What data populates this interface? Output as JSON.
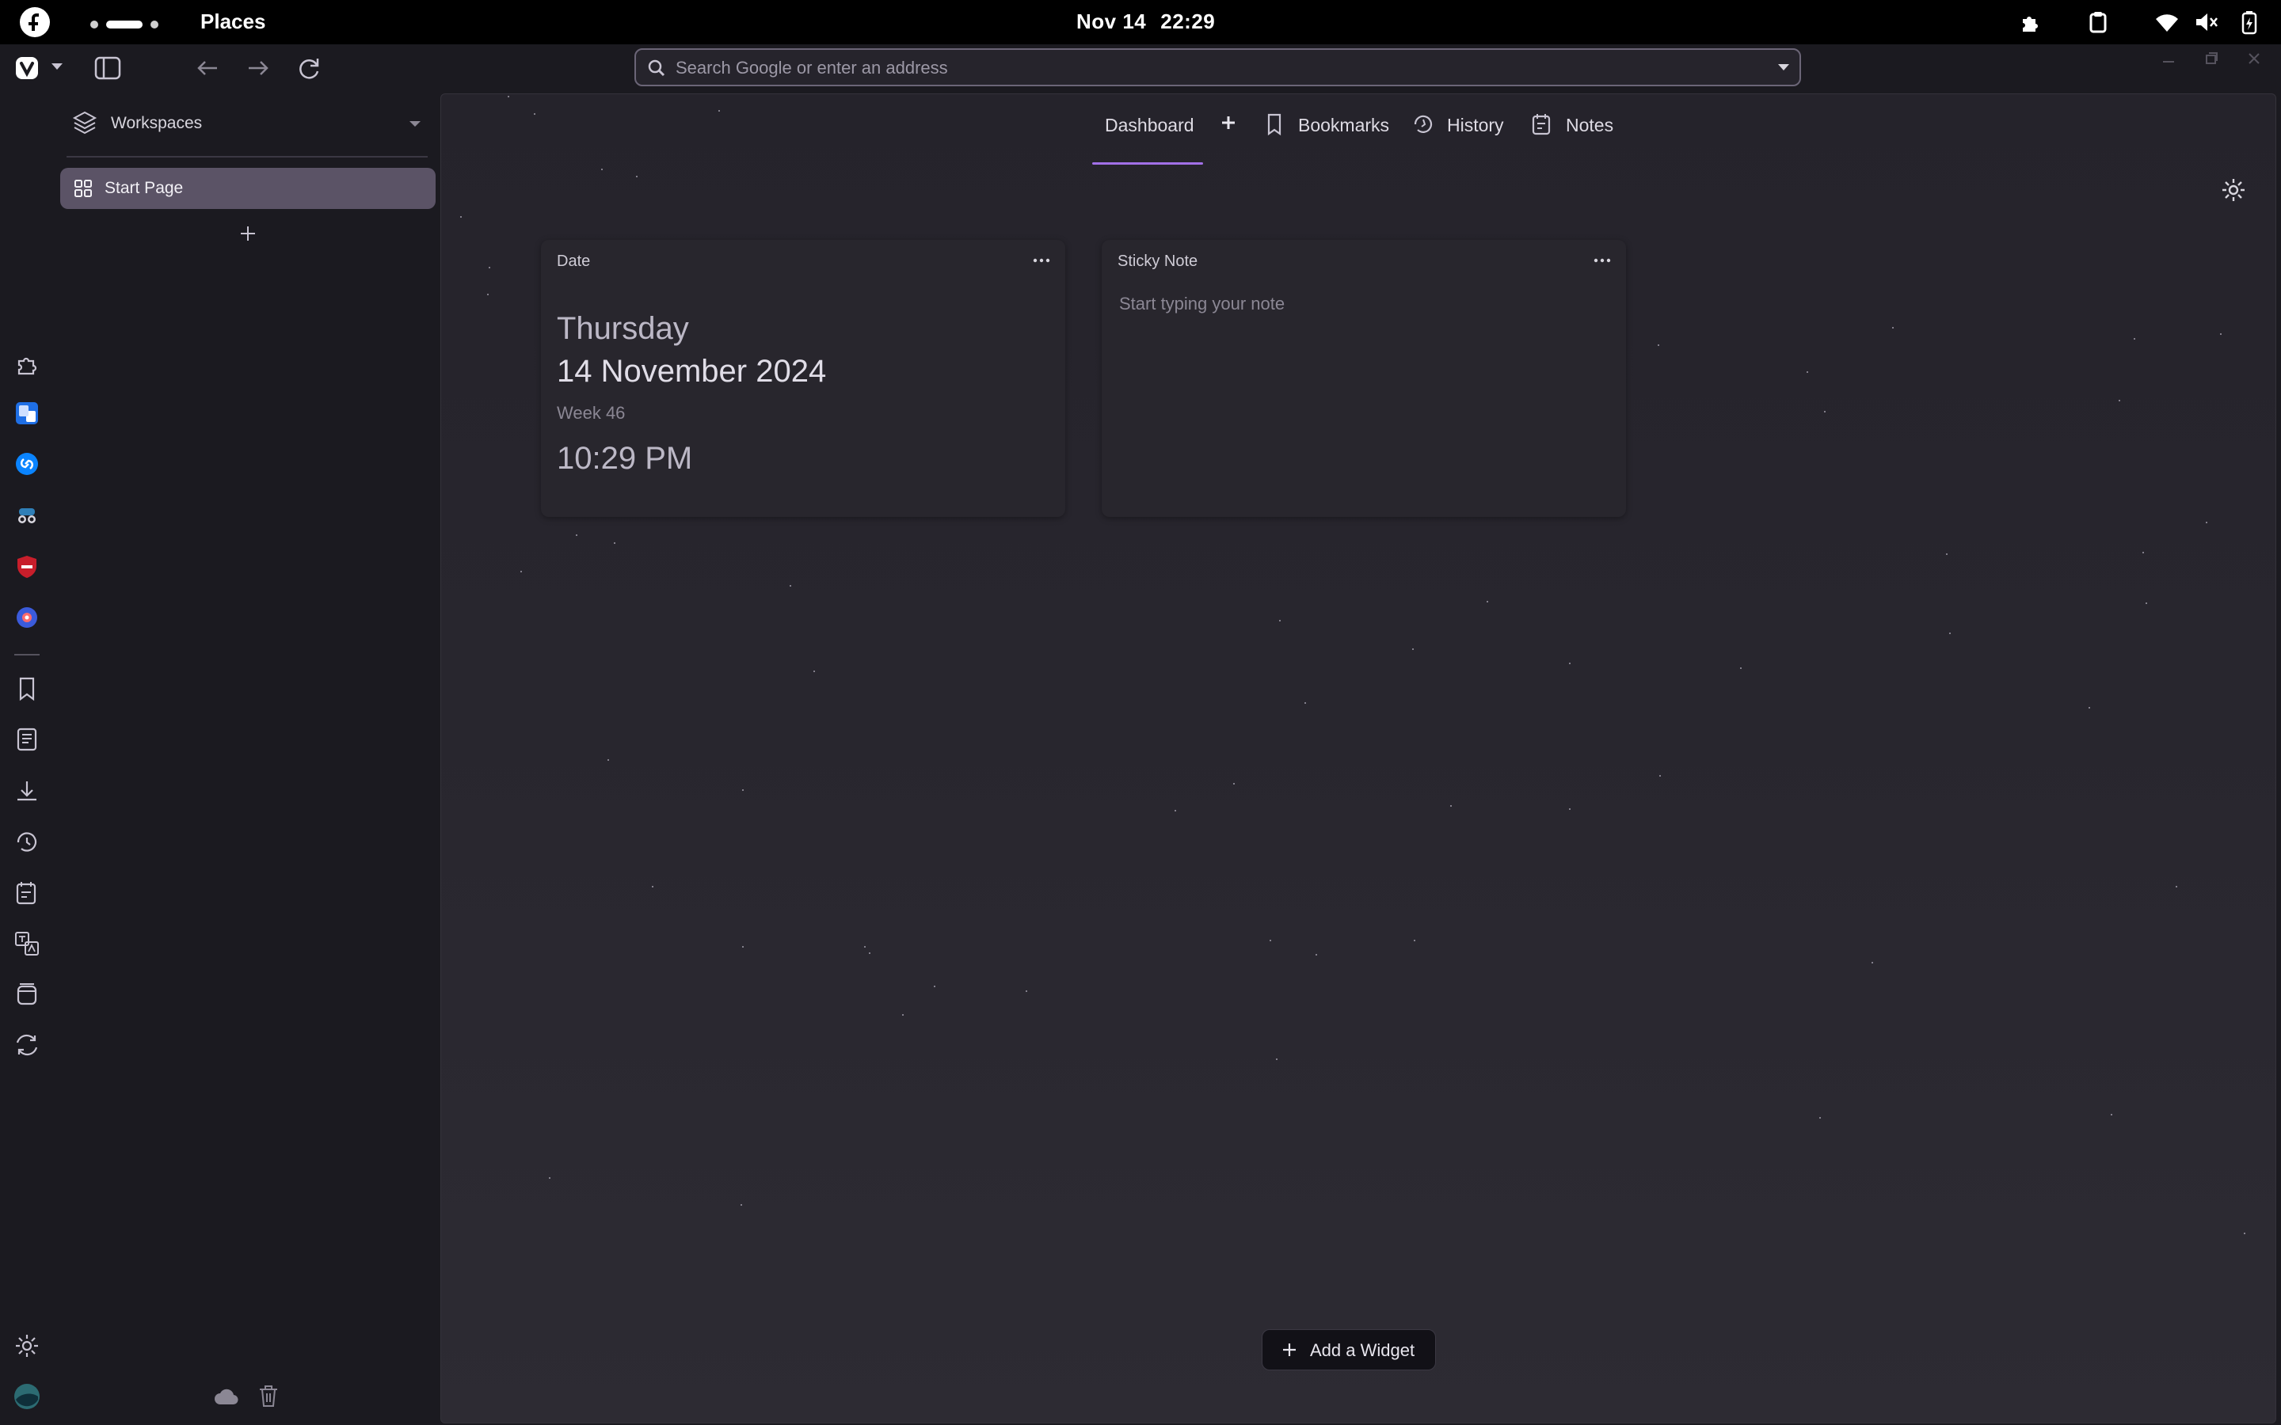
{
  "system_bar": {
    "app_name": "Places",
    "date": "Nov 14",
    "time": "22:29"
  },
  "browser": {
    "address_placeholder": "Search Google or enter an address"
  },
  "panel": {
    "workspaces_label": "Workspaces",
    "tabs": [
      {
        "label": "Start Page",
        "active": true
      }
    ]
  },
  "dashboard": {
    "nav_tabs": [
      {
        "label": "Dashboard",
        "active": true
      },
      {
        "label": "Bookmarks"
      },
      {
        "label": "History"
      },
      {
        "label": "Notes"
      }
    ],
    "widgets": {
      "date": {
        "title": "Date",
        "weekday": "Thursday",
        "full_date": "14 November 2024",
        "week": "Week 46",
        "time": "10:29 PM"
      },
      "sticky_note": {
        "title": "Sticky Note",
        "placeholder": "Start typing your note"
      }
    },
    "add_widget_label": "Add a Widget"
  },
  "colors": {
    "accent": "#a270e8",
    "active_tab_bg": "#5b5366",
    "background": "#1b1a20"
  }
}
